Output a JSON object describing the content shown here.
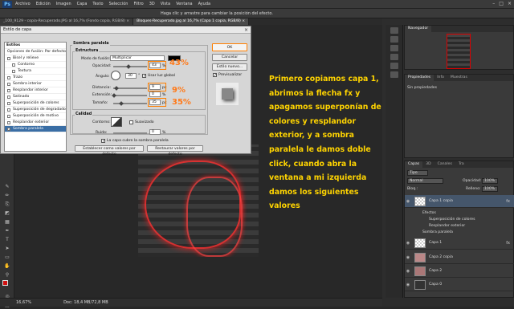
{
  "app": {
    "logo": "Ps"
  },
  "menu": [
    "Archivo",
    "Edición",
    "Imagen",
    "Capa",
    "Texto",
    "Selección",
    "Filtro",
    "3D",
    "Vista",
    "Ventana",
    "Ayuda"
  ],
  "options_hint": "Haga clic y arrastre para cambiar la posición del efecto.",
  "tabs": [
    {
      "label": "_100_9129 - copia-Recuperado.JPG al 16,7% (Fondo copia, RGB/8) ×",
      "active": false
    },
    {
      "label": "Bloques-Recuperado.jpg al 16,7% (Capa 1 copia, RGB/8) ×",
      "active": true
    }
  ],
  "status": {
    "zoom": "16,67%",
    "doc": "Doc: 18,4 MB/72,8 MB"
  },
  "dialog": {
    "title": "Estilo de capa",
    "left_list": [
      {
        "label": "Estilos",
        "type": "hdr"
      },
      {
        "label": "Opciones de fusión: Por defecto",
        "type": "plain"
      },
      {
        "label": "Bisel y relieve",
        "type": "cb"
      },
      {
        "label": "Contorno",
        "type": "sub"
      },
      {
        "label": "Textura",
        "type": "sub"
      },
      {
        "label": "Trazo",
        "type": "cb"
      },
      {
        "label": "Sombra interior",
        "type": "cb"
      },
      {
        "label": "Resplandor interior",
        "type": "cb"
      },
      {
        "label": "Satinado",
        "type": "cb"
      },
      {
        "label": "Superposición de colores",
        "type": "cb"
      },
      {
        "label": "Superposición de degradado",
        "type": "cb"
      },
      {
        "label": "Superposición de motivo",
        "type": "cb"
      },
      {
        "label": "Resplandor exterior",
        "type": "cb"
      },
      {
        "label": "Sombra paralela",
        "type": "sel"
      }
    ],
    "section_title": "Sombra paralela",
    "estructura": "Estructura",
    "blend_label": "Modo de fusión:",
    "blend_value": "Multiplicar",
    "opacity_label": "Opacidad:",
    "opacity_value": "43",
    "angle_label": "Ángulo:",
    "angle_value": "30",
    "global_light": "Usar luz global",
    "distance_label": "Distancia:",
    "distance_value": "9",
    "spread_label": "Extensión:",
    "spread_value": "0",
    "size_label": "Tamaño:",
    "size_value": "35",
    "unit_pct": "%",
    "unit_px": "px",
    "calidad": "Calidad",
    "contour_label": "Contorno:",
    "antialias": "Suavizado",
    "noise_label": "Ruido:",
    "noise_value": "0",
    "knockout": "La capa cubre la sombra paralela",
    "btn_default": "Establecer como valores por defecto",
    "btn_restore": "Restaurar valores por defecto",
    "ok": "OK",
    "cancel": "Cancelar",
    "new_style": "Estilo nuevo...",
    "preview": "Previsualizar"
  },
  "callouts": {
    "opacity": "43%",
    "distance": "9%",
    "size": "35%"
  },
  "note": "Primero copiamos capa 1, abrimos la flecha fx y apagamos superponían de colores y resplandor exterior, y a sombra paralela le damos doble click, cuando abra la ventana a mi izquierda damos los siguientes valores",
  "navigator": {
    "title": "Navegador"
  },
  "properties": {
    "tabs": [
      "Propiedades",
      "Info",
      "Muestras"
    ],
    "empty": "Sin propiedades"
  },
  "layers_panel": {
    "tabs": [
      "Capas",
      "3D",
      "Canales",
      "Tra"
    ],
    "kind": "Tipo",
    "mode": "Normal",
    "opacity_label": "Opacidad:",
    "opacity_value": "100%",
    "lock_label": "Bloq.:",
    "fill_label": "Relleno:",
    "fill_value": "100%",
    "layers": [
      {
        "name": "Capa 1 copia",
        "active": true,
        "fx": "fx"
      },
      {
        "name": "Capa 1",
        "active": false,
        "fx": "fx"
      },
      {
        "name": "Capa 2 copia",
        "active": false,
        "fx": ""
      },
      {
        "name": "Capa 2",
        "active": false,
        "fx": ""
      },
      {
        "name": "Capa 0",
        "active": false,
        "fx": ""
      }
    ],
    "effects_label": "Efectos",
    "effects": [
      "Superposición de colores",
      "Resplandor exterior",
      "Sombra paralela"
    ]
  },
  "colors": {
    "accent": "#ff7f00",
    "note": "#ffd400",
    "glow": "#ff3030"
  }
}
